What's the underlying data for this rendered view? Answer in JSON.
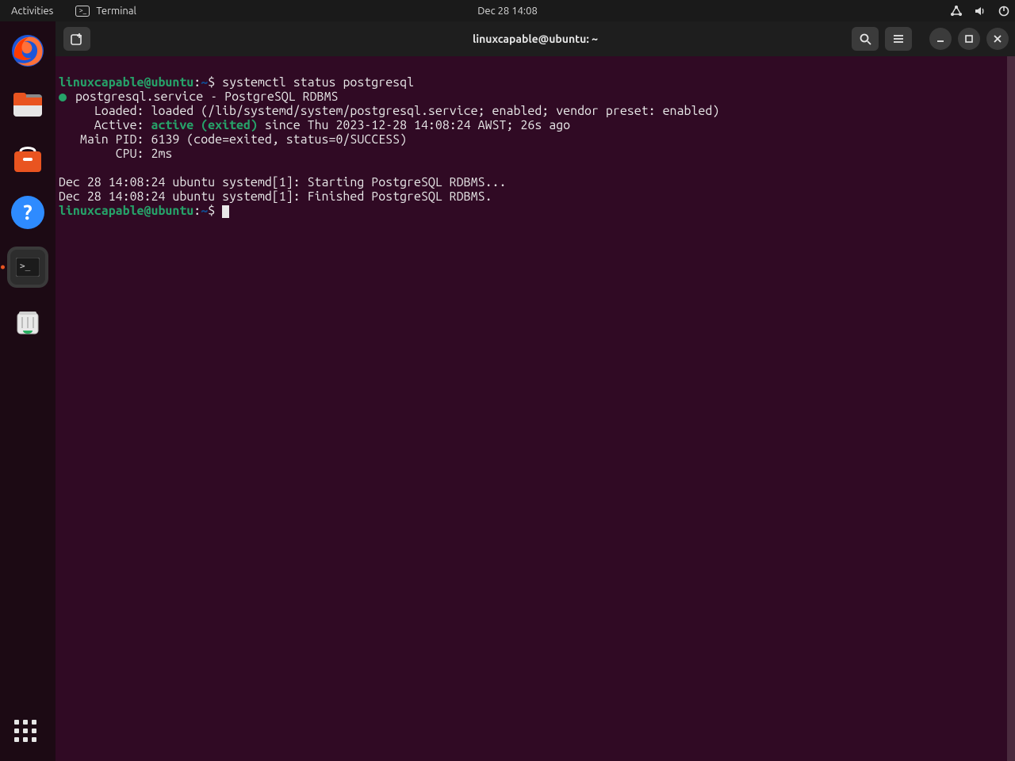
{
  "topbar": {
    "activities": "Activities",
    "app_label": "Terminal",
    "clock": "Dec 28  14:08"
  },
  "dock": {
    "items": [
      "firefox",
      "files",
      "software",
      "help",
      "terminal",
      "trash"
    ]
  },
  "window": {
    "title": "linuxcapable@ubuntu: ~"
  },
  "prompt": {
    "userhost": "linuxcapable@ubuntu",
    "sep": ":",
    "cwd": "~",
    "sigil": "$"
  },
  "cmd1": "systemctl status postgresql",
  "out": {
    "unit_line": "postgresql.service - PostgreSQL RDBMS",
    "loaded": "     Loaded: loaded (/lib/systemd/system/postgresql.service; enabled; vendor preset: enabled)",
    "active_prefix": "     Active: ",
    "active_status": "active (exited)",
    "active_suffix": " since Thu 2023-12-28 14:08:24 AWST; 26s ago",
    "mainpid": "   Main PID: 6139 (code=exited, status=0/SUCCESS)",
    "cpu": "        CPU: 2ms",
    "blank": "",
    "log1": "Dec 28 14:08:24 ubuntu systemd[1]: Starting PostgreSQL RDBMS...",
    "log2": "Dec 28 14:08:24 ubuntu systemd[1]: Finished PostgreSQL RDBMS."
  }
}
